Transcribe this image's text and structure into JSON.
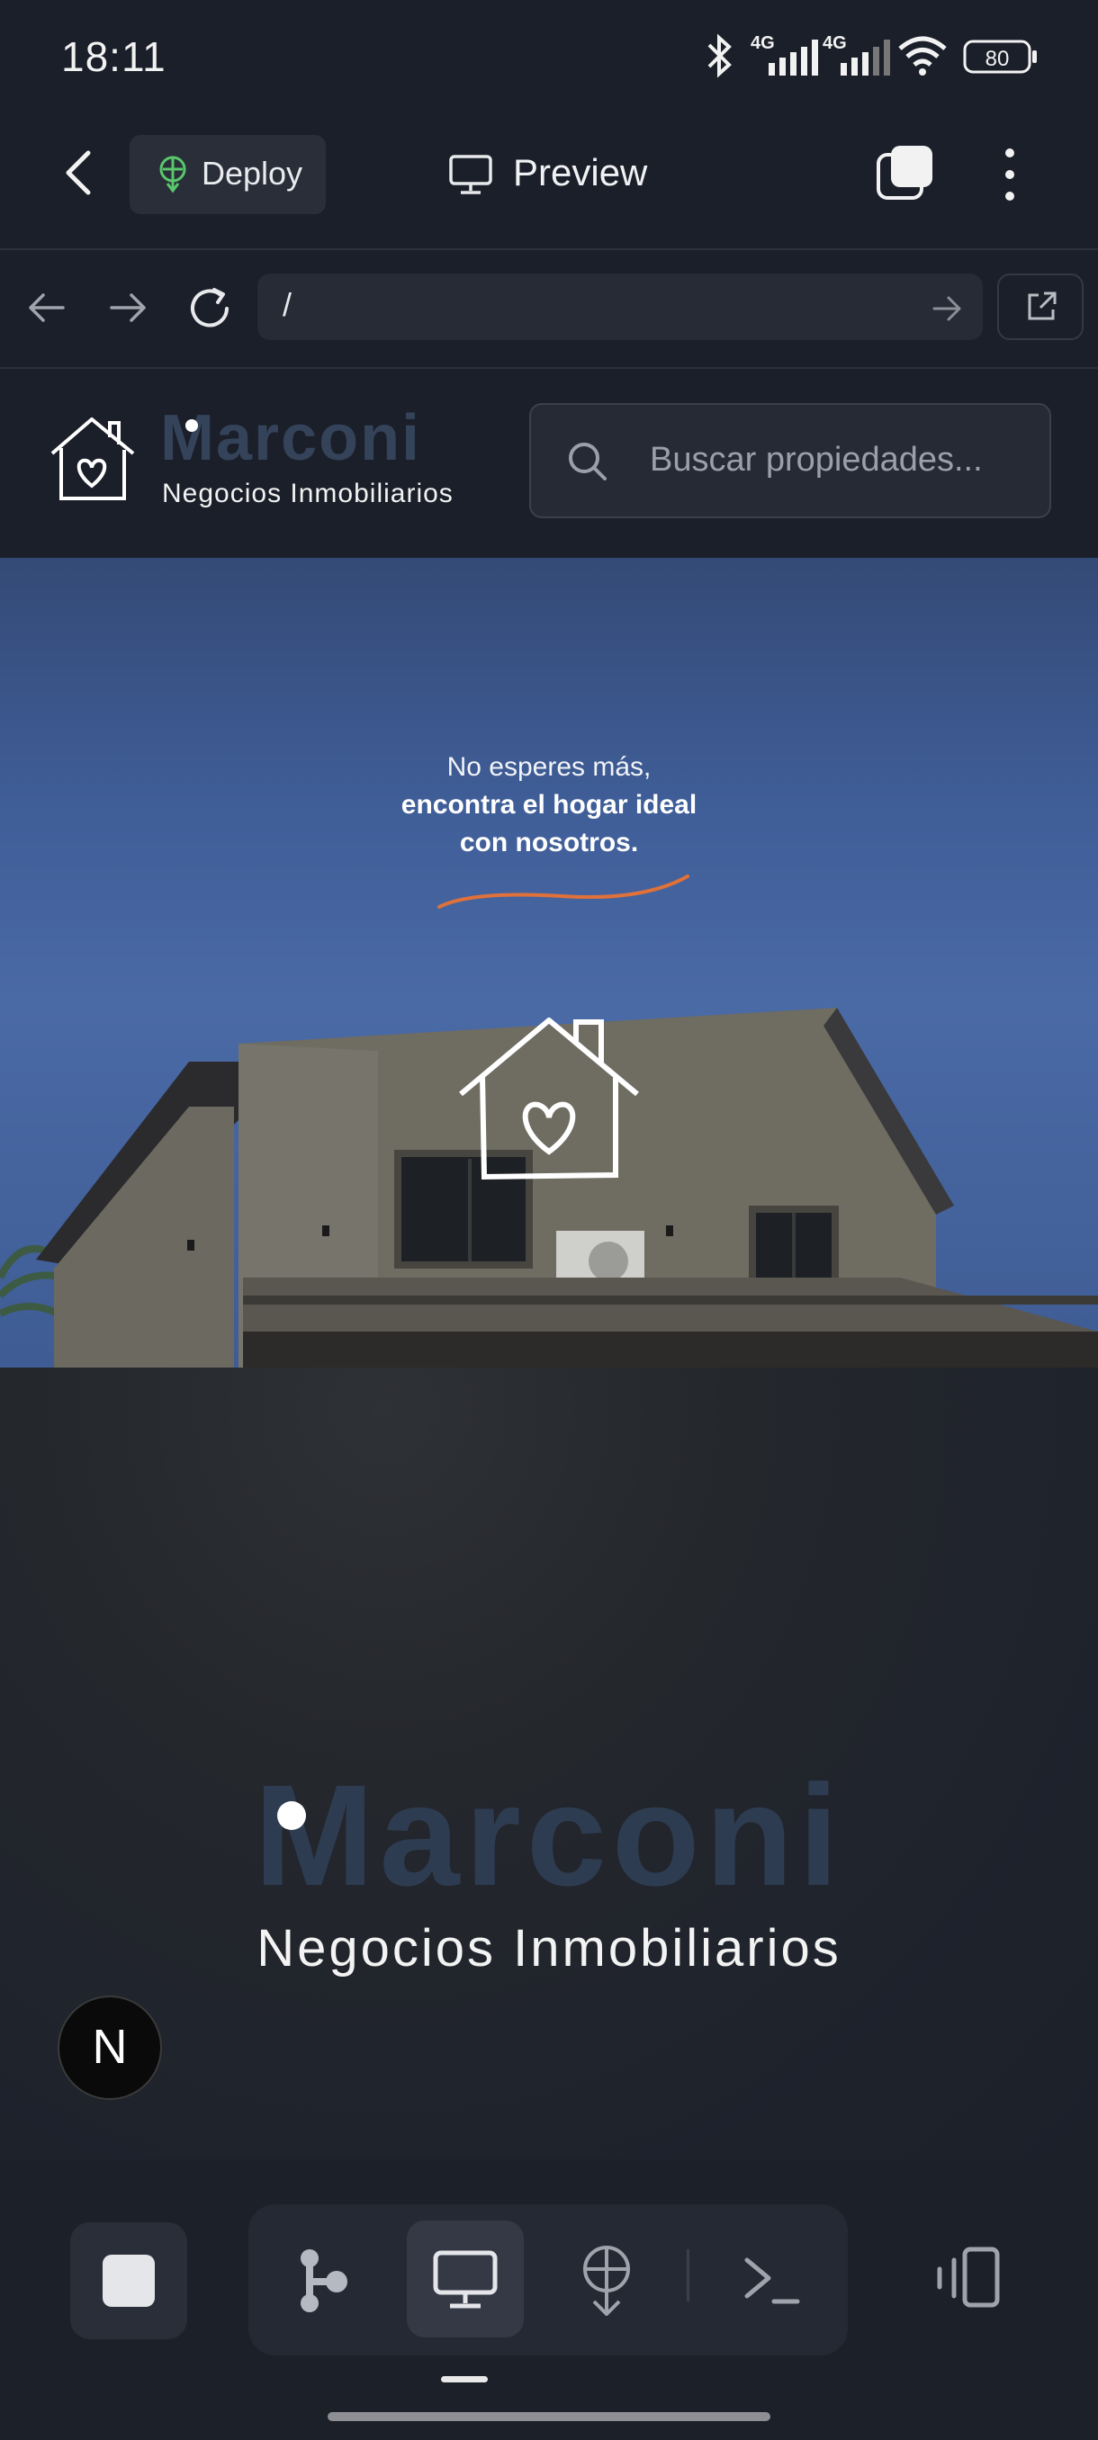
{
  "status_bar": {
    "time": "18:11",
    "network_1": "4G",
    "network_2": "4G",
    "battery": "80",
    "icons": [
      "bluetooth-icon",
      "signal-icon",
      "signal-icon",
      "wifi-icon",
      "battery-icon"
    ]
  },
  "app_bar": {
    "deploy_label": "Deploy",
    "preview_label": "Preview",
    "icons": [
      "back-icon",
      "deploy-icon",
      "monitor-icon",
      "tabs-icon",
      "more-icon"
    ]
  },
  "browser": {
    "url": "/",
    "icons": [
      "back-arrow-icon",
      "forward-arrow-icon",
      "reload-icon",
      "go-arrow-icon",
      "external-link-icon"
    ]
  },
  "site": {
    "logo_title": "Marconi",
    "logo_subtitle": "Negocios Inmobiliarios",
    "search_placeholder": "Buscar propiedades...",
    "hero": {
      "line1": "No esperes más,",
      "line2": "encontra el hogar ideal",
      "line3": "con nosotros."
    },
    "splash_title": "Marconi",
    "splash_subtitle": "Negocios Inmobiliarios",
    "badge_letter": "N"
  },
  "bottom_bar": {
    "icons": [
      "stop-icon",
      "branch-icon",
      "monitor-icon",
      "deploy-icon",
      "terminal-icon",
      "devices-icon"
    ]
  },
  "colors": {
    "background": "#1b1f29",
    "hero_sky": "#4a6aa6",
    "accent_orange": "#e0713a",
    "logo_navy": "#34435a",
    "deploy_green": "#58c76b"
  }
}
